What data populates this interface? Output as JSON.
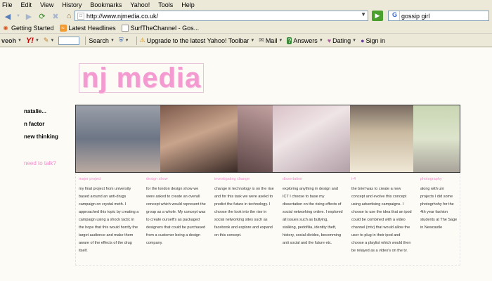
{
  "menu": [
    "File",
    "Edit",
    "View",
    "History",
    "Bookmarks",
    "Yahoo!",
    "Tools",
    "Help"
  ],
  "address": {
    "url": "http://www.njmedia.co.uk/"
  },
  "search": {
    "value": "gossip girl"
  },
  "bookmarks": [
    "Getting Started",
    "Latest Headlines",
    "SurfTheChannel - Gos..."
  ],
  "yahoo_toolbar": {
    "search_label": "Search",
    "upgrade_label": "Upgrade to the latest Yahoo! Toolbar",
    "mail_label": "Mail",
    "answers_label": "Answers",
    "dating_label": "Dating",
    "signin_label": "Sign in"
  },
  "site": {
    "logo": "nj media",
    "nav": [
      "natalie...",
      "n factor",
      "new thinking"
    ],
    "contact": "need to talk?",
    "accent_color": "#f08ccb"
  },
  "projects": [
    {
      "title": "major project",
      "text": "my final project from university based around an anti-drugs campaign on crystal meth. I approached this topic by creating a campaign using a shock tactic in the hope that this would horrify the target audience and make them aware of the effects of the drug itself."
    },
    {
      "title": "design show",
      "text": "for the london design show we were asked to create an overall concept which would represent the group as a whole. My concept was to create ourself's as packaged designers that could be purchased from a customer being a design company."
    },
    {
      "title": "investigating change",
      "text": "change in technology is on the rise and for this task we were asekd to predict the future in technology. I choose the look into the rise in social networking sites such as facebook and explore and expand on this concept."
    },
    {
      "title": "dissertation",
      "text": "exploring anything in design and ICT I choose to base my dissertation on the rising effects of social networking online. I explored all issues such as bullying, stalking, pedofilia, identity theft, history, social divides, becomming anti social and the future etc."
    },
    {
      "title": "i-4",
      "text": "the brief was to create a new concept and evolve this concept using advertising campaigns. I choose to use the idea that an ipod could be combined with a video channel (mtv) that would allow the user to plug in their ipod and choose a playlist which would then be relayed as a video's on the tv."
    },
    {
      "title": "photography",
      "text": "along with uni projects I did some photogrhohy for the 4th year fashion students at The Sage in Newcastle"
    }
  ]
}
